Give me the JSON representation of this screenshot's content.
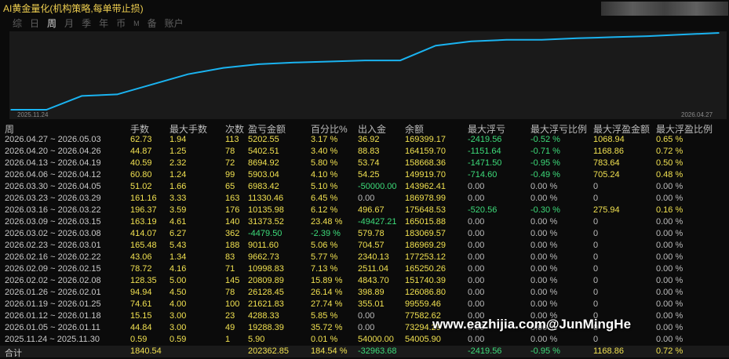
{
  "app": {
    "title": "AI黄金量化(机构策略,每单带止损)"
  },
  "tabs": [
    {
      "label": "综"
    },
    {
      "label": "日"
    },
    {
      "label": "周"
    },
    {
      "label": "月"
    },
    {
      "label": "季"
    },
    {
      "label": "年"
    },
    {
      "label": "币"
    },
    {
      "label": "M"
    },
    {
      "label": "备"
    },
    {
      "label": "账户"
    }
  ],
  "active_tab": "周",
  "colors": {
    "line": "#1ab3f0",
    "positive": "#f0e050",
    "negative": "#3ddc7a",
    "neutral": "#bbbbbb",
    "title": "#f0d050",
    "background": "#0b0b0b",
    "chart_bg": "#1a1a1a"
  },
  "chart_data": {
    "type": "line",
    "x_start_label": "2025.11.24",
    "x_end_label": "2026.04.27",
    "series": [
      {
        "values": [
          0.0,
          0.0,
          0.26,
          0.29,
          0.48,
          0.67,
          0.79,
          0.86,
          0.89,
          0.91,
          0.93,
          0.93,
          1.21,
          1.29,
          1.32,
          1.32,
          1.35,
          1.37,
          1.39,
          1.42,
          1.45
        ]
      }
    ]
  },
  "table": {
    "columns": [
      "周",
      "手数",
      "最大手数",
      "次数",
      "盈亏金额",
      "百分比%",
      "出入金",
      "余额",
      "最大浮亏",
      "最大浮亏比例",
      "最大浮盈金额",
      "最大浮盈比例"
    ],
    "rows": [
      [
        "2026.04.27 ~ 2026.05.03",
        "62.73",
        "1.94",
        "113",
        "5202.55",
        "3.17 %",
        "36.92",
        "169399.17",
        "-2419.56",
        "-0.52 %",
        "1068.94",
        "0.65 %"
      ],
      [
        "2026.04.20 ~ 2026.04.26",
        "44.87",
        "1.25",
        "78",
        "5402.51",
        "3.40 %",
        "88.83",
        "164159.70",
        "-1151.64",
        "-0.71 %",
        "1168.86",
        "0.72 %"
      ],
      [
        "2026.04.13 ~ 2026.04.19",
        "40.59",
        "2.32",
        "72",
        "8694.92",
        "5.80 %",
        "53.74",
        "158668.36",
        "-1471.50",
        "-0.95 %",
        "783.64",
        "0.50 %"
      ],
      [
        "2026.04.06 ~ 2026.04.12",
        "60.80",
        "1.24",
        "99",
        "5903.04",
        "4.10 %",
        "54.25",
        "149919.70",
        "-714.60",
        "-0.49 %",
        "705.24",
        "0.48 %"
      ],
      [
        "2026.03.30 ~ 2026.04.05",
        "51.02",
        "1.66",
        "65",
        "6983.42",
        "5.10 %",
        "-50000.00",
        "143962.41",
        "0.00",
        "0.00 %",
        "0",
        "0.00 %"
      ],
      [
        "2026.03.23 ~ 2026.03.29",
        "161.16",
        "3.33",
        "163",
        "11330.46",
        "6.45 %",
        "0.00",
        "186978.99",
        "0.00",
        "0.00 %",
        "0",
        "0.00 %"
      ],
      [
        "2026.03.16 ~ 2026.03.22",
        "196.37",
        "3.59",
        "176",
        "10135.98",
        "6.12 %",
        "496.67",
        "175648.53",
        "-520.56",
        "-0.30 %",
        "275.94",
        "0.16 %"
      ],
      [
        "2026.03.09 ~ 2026.03.15",
        "163.19",
        "4.61",
        "140",
        "31373.52",
        "23.48 %",
        "-49427.21",
        "165015.88",
        "0.00",
        "0.00 %",
        "0",
        "0.00 %"
      ],
      [
        "2026.03.02 ~ 2026.03.08",
        "414.07",
        "6.27",
        "362",
        "-4479.50",
        "-2.39 %",
        "579.78",
        "183069.57",
        "0.00",
        "0.00 %",
        "0",
        "0.00 %"
      ],
      [
        "2026.02.23 ~ 2026.03.01",
        "165.48",
        "5.43",
        "188",
        "9011.60",
        "5.06 %",
        "704.57",
        "186969.29",
        "0.00",
        "0.00 %",
        "0",
        "0.00 %"
      ],
      [
        "2026.02.16 ~ 2026.02.22",
        "43.06",
        "1.34",
        "83",
        "9662.73",
        "5.77 %",
        "2340.13",
        "177253.12",
        "0.00",
        "0.00 %",
        "0",
        "0.00 %"
      ],
      [
        "2026.02.09 ~ 2026.02.15",
        "78.72",
        "4.16",
        "71",
        "10998.83",
        "7.13 %",
        "2511.04",
        "165250.26",
        "0.00",
        "0.00 %",
        "0",
        "0.00 %"
      ],
      [
        "2026.02.02 ~ 2026.02.08",
        "128.35",
        "5.00",
        "145",
        "20809.89",
        "15.89 %",
        "4843.70",
        "151740.39",
        "0.00",
        "0.00 %",
        "0",
        "0.00 %"
      ],
      [
        "2026.01.26 ~ 2026.02.01",
        "94.94",
        "4.50",
        "78",
        "26128.45",
        "26.14 %",
        "398.89",
        "126086.80",
        "0.00",
        "0.00 %",
        "0",
        "0.00 %"
      ],
      [
        "2026.01.19 ~ 2026.01.25",
        "74.61",
        "4.00",
        "100",
        "21621.83",
        "27.74 %",
        "355.01",
        "99559.46",
        "0.00",
        "0.00 %",
        "0",
        "0.00 %"
      ],
      [
        "2026.01.12 ~ 2026.01.18",
        "15.15",
        "3.00",
        "23",
        "4288.33",
        "5.85 %",
        "0.00",
        "77582.62",
        "0.00",
        "0.00 %",
        "0",
        "0.00 %"
      ],
      [
        "2026.01.05 ~ 2026.01.11",
        "44.84",
        "3.00",
        "49",
        "19288.39",
        "35.72 %",
        "0.00",
        "73294.29",
        "0.00",
        "0.00 %",
        "0",
        "0.00 %"
      ],
      [
        "2025.11.24 ~ 2025.11.30",
        "0.59",
        "0.59",
        "1",
        "5.90",
        "0.01 %",
        "54000.00",
        "54005.90",
        "0.00",
        "0.00 %",
        "0",
        "0.00 %"
      ]
    ],
    "total": [
      "合计",
      "1840.54",
      "",
      "",
      "202362.85",
      "184.54 %",
      "-32963.68",
      "",
      "-2419.56",
      "-0.95 %",
      "1168.86",
      "0.72 %"
    ]
  },
  "watermark": "www.eazhijia.com@JunMingHe"
}
